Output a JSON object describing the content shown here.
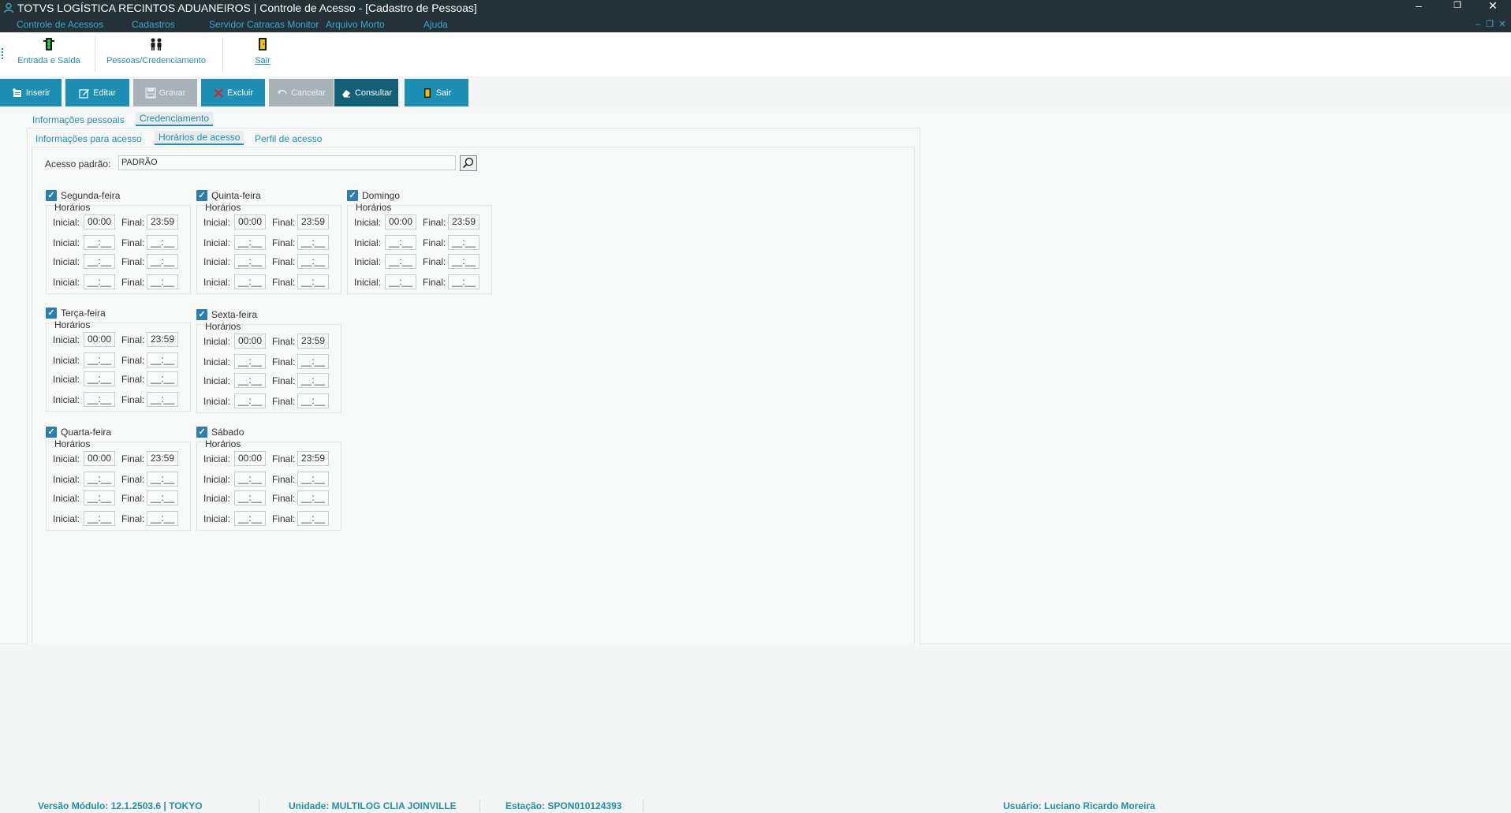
{
  "window": {
    "title": "TOTVS LOGÍSTICA RECINTOS ADUANEIROS | Controle de Acesso - [Cadastro de Pessoas]",
    "minimize": "–",
    "restore": "❐",
    "close": "✕"
  },
  "menu": [
    "Controle de Acessos",
    "Cadastros",
    "Servidor Catracas Monitor",
    "Arquivo Morto",
    "Ajuda"
  ],
  "mdi": {
    "minimize": "–",
    "restore": "❐",
    "close": "✕"
  },
  "ribbon": {
    "entrada_saida": "Entrada e Saída",
    "pessoas": "Pessoas/Credenciamento",
    "sair": "Sair"
  },
  "toolbar": {
    "inserir": "Inserir",
    "editar": "Editar",
    "gravar": "Gravar",
    "excluir": "Excluir",
    "cancelar": "Cancelar",
    "consultar": "Consultar",
    "sair": "Sair"
  },
  "tabs": {
    "info_pessoais": "Informações pessoais",
    "credenciamento": "Credenciamento",
    "info_acesso": "Informações para acesso",
    "horarios": "Horários de acesso",
    "perfil": "Perfil de acesso"
  },
  "acesso_padrao": {
    "label": "Acesso padrão:",
    "value": "PADRÃO"
  },
  "labels": {
    "horarios": "Horários",
    "inicial": "Inicial:",
    "final": "Final:"
  },
  "days": {
    "segunda": {
      "name": "Segunda-feira",
      "checked": true,
      "rows": [
        [
          "00:00",
          "23:59"
        ],
        [
          "__:__",
          "__:__"
        ],
        [
          "__:__",
          "__:__"
        ],
        [
          "__:__",
          "__:__"
        ]
      ]
    },
    "terca": {
      "name": "Terça-feira",
      "checked": true,
      "rows": [
        [
          "00:00",
          "23:59"
        ],
        [
          "__:__",
          "__:__"
        ],
        [
          "__:__",
          "__:__"
        ],
        [
          "__:__",
          "__:__"
        ]
      ]
    },
    "quarta": {
      "name": "Quarta-feira",
      "checked": true,
      "rows": [
        [
          "00:00",
          "23:59"
        ],
        [
          "__:__",
          "__:__"
        ],
        [
          "__:__",
          "__:__"
        ],
        [
          "__:__",
          "__:__"
        ]
      ]
    },
    "quinta": {
      "name": "Quinta-feira",
      "checked": true,
      "rows": [
        [
          "00:00",
          "23:59"
        ],
        [
          "__:__",
          "__:__"
        ],
        [
          "__:__",
          "__:__"
        ],
        [
          "__:__",
          "__:__"
        ]
      ]
    },
    "sexta": {
      "name": "Sexta-feira",
      "checked": true,
      "rows": [
        [
          "00:00",
          "23:59"
        ],
        [
          "__:__",
          "__:__"
        ],
        [
          "__:__",
          "__:__"
        ],
        [
          "__:__",
          "__:__"
        ]
      ]
    },
    "sabado": {
      "name": "Sábado",
      "checked": true,
      "rows": [
        [
          "00:00",
          "23:59"
        ],
        [
          "__:__",
          "__:__"
        ],
        [
          "__:__",
          "__:__"
        ],
        [
          "__:__",
          "__:__"
        ]
      ]
    },
    "domingo": {
      "name": "Domingo",
      "checked": true,
      "rows": [
        [
          "00:00",
          "23:59"
        ],
        [
          "__:__",
          "__:__"
        ],
        [
          "__:__",
          "__:__"
        ],
        [
          "__:__",
          "__:__"
        ]
      ]
    }
  },
  "status": {
    "versao": "Versão Módulo:  12.1.2503.6  |  TOKYO",
    "unidade": "Unidade: MULTILOG CLIA JOINVILLE",
    "estacao": "Estação: SPON010124393",
    "usuario": "Usuário: Luciano Ricardo Moreira"
  },
  "colors": {
    "titlebar": "#243238",
    "accent": "#1d8fb5",
    "checkbox": "#2a7fb0"
  }
}
